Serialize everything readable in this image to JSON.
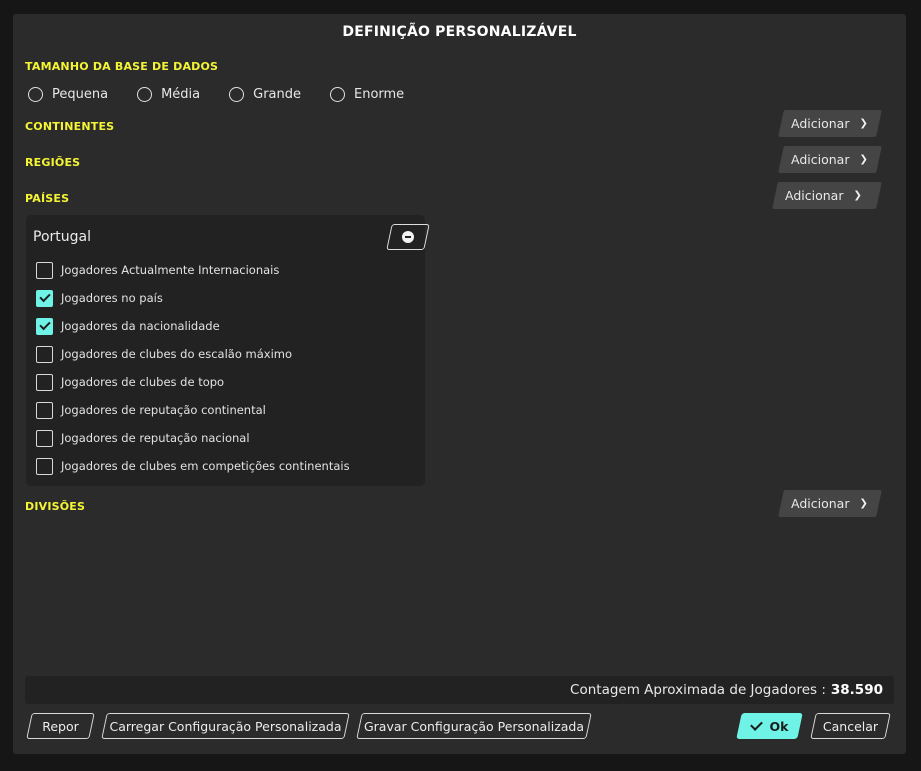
{
  "dialog": {
    "title": "DEFINIÇÃO PERSONALIZÁVEL"
  },
  "database_size": {
    "label": "TAMANHO DA BASE DE DADOS",
    "options": [
      "Pequena",
      "Média",
      "Grande",
      "Enorme"
    ],
    "selected": null
  },
  "sections": {
    "continents": "CONTINENTES",
    "regions": "REGIÕES",
    "countries": "PAÍSES",
    "divisions": "DIVISÕES"
  },
  "add_button_label": "Adicionar",
  "country": {
    "name": "Portugal",
    "options": [
      {
        "label": "Jogadores Actualmente Internacionais",
        "checked": false
      },
      {
        "label": "Jogadores no país",
        "checked": true
      },
      {
        "label": "Jogadores da nacionalidade",
        "checked": true
      },
      {
        "label": "Jogadores de clubes do escalão máximo",
        "checked": false
      },
      {
        "label": "Jogadores de clubes de topo",
        "checked": false
      },
      {
        "label": "Jogadores de reputação continental",
        "checked": false
      },
      {
        "label": "Jogadores de reputação nacional",
        "checked": false
      },
      {
        "label": "Jogadores de clubes em competições continentais",
        "checked": false
      }
    ]
  },
  "player_count": {
    "label": "Contagem Aproximada de Jogadores :",
    "value": "38.590"
  },
  "footer": {
    "reset": "Repor",
    "load": "Carregar Configuração Personalizada",
    "save": "Gravar Configuração Personalizada",
    "ok": "Ok",
    "cancel": "Cancelar"
  },
  "colors": {
    "accent": "#6ff3e6",
    "section_label": "#f5f535",
    "dialog_bg": "#2b2b2b",
    "panel_bg": "#222222"
  }
}
